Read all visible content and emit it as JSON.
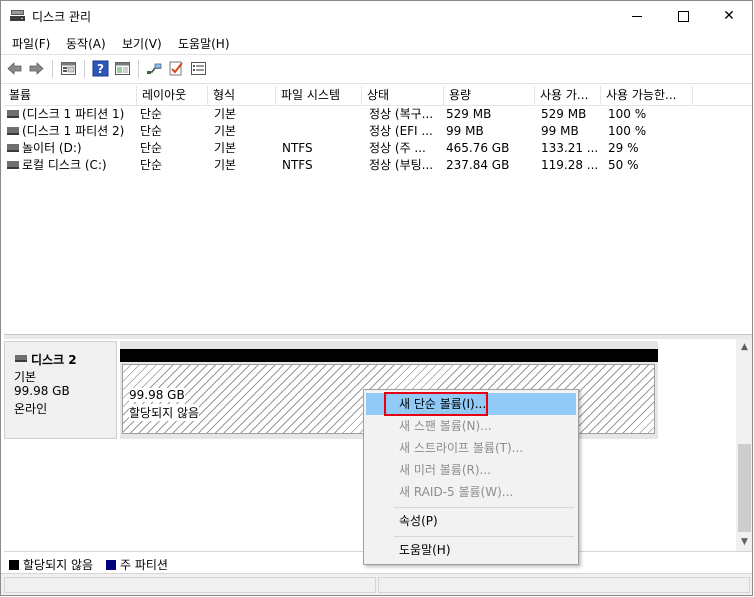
{
  "window": {
    "title": "디스크 관리"
  },
  "menu": [
    "파일(F)",
    "동작(A)",
    "보기(V)",
    "도움말(H)"
  ],
  "columns": [
    "볼륨",
    "레이아웃",
    "형식",
    "파일 시스템",
    "상태",
    "용량",
    "사용 가...",
    "사용 가능한..."
  ],
  "volumes": [
    {
      "name": "(디스크 1 파티션 1)",
      "layout": "단순",
      "type": "기본",
      "fs": "",
      "status": "정상 (복구...",
      "capacity": "529 MB",
      "free": "529 MB",
      "pct": "100 %"
    },
    {
      "name": "(디스크 1 파티션 2)",
      "layout": "단순",
      "type": "기본",
      "fs": "",
      "status": "정상 (EFI ...",
      "capacity": "99 MB",
      "free": "99 MB",
      "pct": "100 %"
    },
    {
      "name": "놀이터 (D:)",
      "layout": "단순",
      "type": "기본",
      "fs": "NTFS",
      "status": "정상 (주 ...",
      "capacity": "465.76 GB",
      "free": "133.21 ...",
      "pct": "29 %"
    },
    {
      "name": "로컬 디스크 (C:)",
      "layout": "단순",
      "type": "기본",
      "fs": "NTFS",
      "status": "정상 (부팅...",
      "capacity": "237.84 GB",
      "free": "119.28 ...",
      "pct": "50 %"
    }
  ],
  "disk": {
    "name": "디스크 2",
    "type": "기본",
    "size": "99.98 GB",
    "status": "온라인",
    "partition": {
      "size": "99.98 GB",
      "label": "할당되지 않음"
    }
  },
  "legend": [
    {
      "label": "할당되지 않음",
      "color": "#000000"
    },
    {
      "label": "주 파티션",
      "color": "#00007c"
    }
  ],
  "context_menu": {
    "items": [
      {
        "label": "새 단순 볼륨(I)...",
        "enabled": true,
        "hover": true
      },
      {
        "label": "새 스팬 볼륨(N)...",
        "enabled": false
      },
      {
        "label": "새 스트라이프 볼륨(T)...",
        "enabled": false
      },
      {
        "label": "새 미러 볼륨(R)...",
        "enabled": false
      },
      {
        "label": "새 RAID-5 볼륨(W)...",
        "enabled": false
      },
      {
        "label": "속성(P)",
        "enabled": true
      },
      {
        "label": "도움말(H)",
        "enabled": true
      }
    ]
  },
  "colors": {
    "hover": "#91c9f7",
    "highlight_border": "#e60012",
    "primary_partition": "#00007c"
  },
  "icons": {
    "toolbar": [
      "back-arrow-icon",
      "forward-arrow-icon",
      "disk-list-icon",
      "help-icon",
      "console-view-icon",
      "connect-icon",
      "check-icon",
      "properties-icon"
    ]
  }
}
